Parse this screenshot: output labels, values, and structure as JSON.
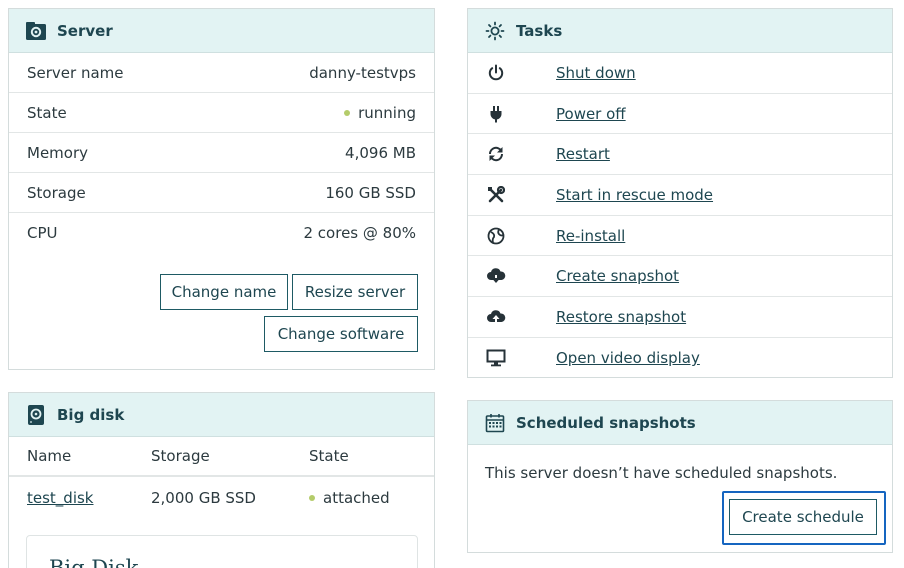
{
  "server": {
    "title": "Server",
    "icon": "server-settings-icon",
    "rows": [
      {
        "label": "Server name",
        "value": "danny-testvps"
      },
      {
        "label": "State",
        "value": "running"
      },
      {
        "label": "Memory",
        "value": "4,096 MB"
      },
      {
        "label": "Storage",
        "value": "160 GB SSD"
      },
      {
        "label": "CPU",
        "value": "2 cores @ 80%"
      }
    ],
    "buttons": {
      "change_name": "Change name",
      "resize": "Resize server",
      "change_software": "Change software"
    }
  },
  "tasks": {
    "title": "Tasks",
    "icon": "sun-icon",
    "items": [
      {
        "label": "Shut down",
        "icon": "power-icon"
      },
      {
        "label": "Power off",
        "icon": "plug-icon"
      },
      {
        "label": "Restart",
        "icon": "restart-icon"
      },
      {
        "label": "Start in rescue mode",
        "icon": "tools-icon"
      },
      {
        "label": "Re-install",
        "icon": "globe-icon"
      },
      {
        "label": "Create snapshot",
        "icon": "cloud-download-icon"
      },
      {
        "label": "Restore snapshot",
        "icon": "cloud-upload-icon"
      },
      {
        "label": "Open video display",
        "icon": "monitor-icon"
      }
    ]
  },
  "bigdisk": {
    "title": "Big disk",
    "icon": "disk-icon",
    "columns": [
      "Name",
      "Storage",
      "State"
    ],
    "rows": [
      {
        "name": "test_disk",
        "storage": "2,000 GB SSD",
        "state": "attached"
      }
    ],
    "card_title": "Big Disk"
  },
  "snapshots": {
    "title": "Scheduled snapshots",
    "icon": "calendar-icon",
    "message": "This server doesn’t have scheduled snapshots.",
    "button": "Create schedule"
  },
  "colors": {
    "header_bg": "#e2f3f3",
    "accent": "#1e4650",
    "status_dot": "#b4cc6a",
    "focus": "#1565c0"
  }
}
